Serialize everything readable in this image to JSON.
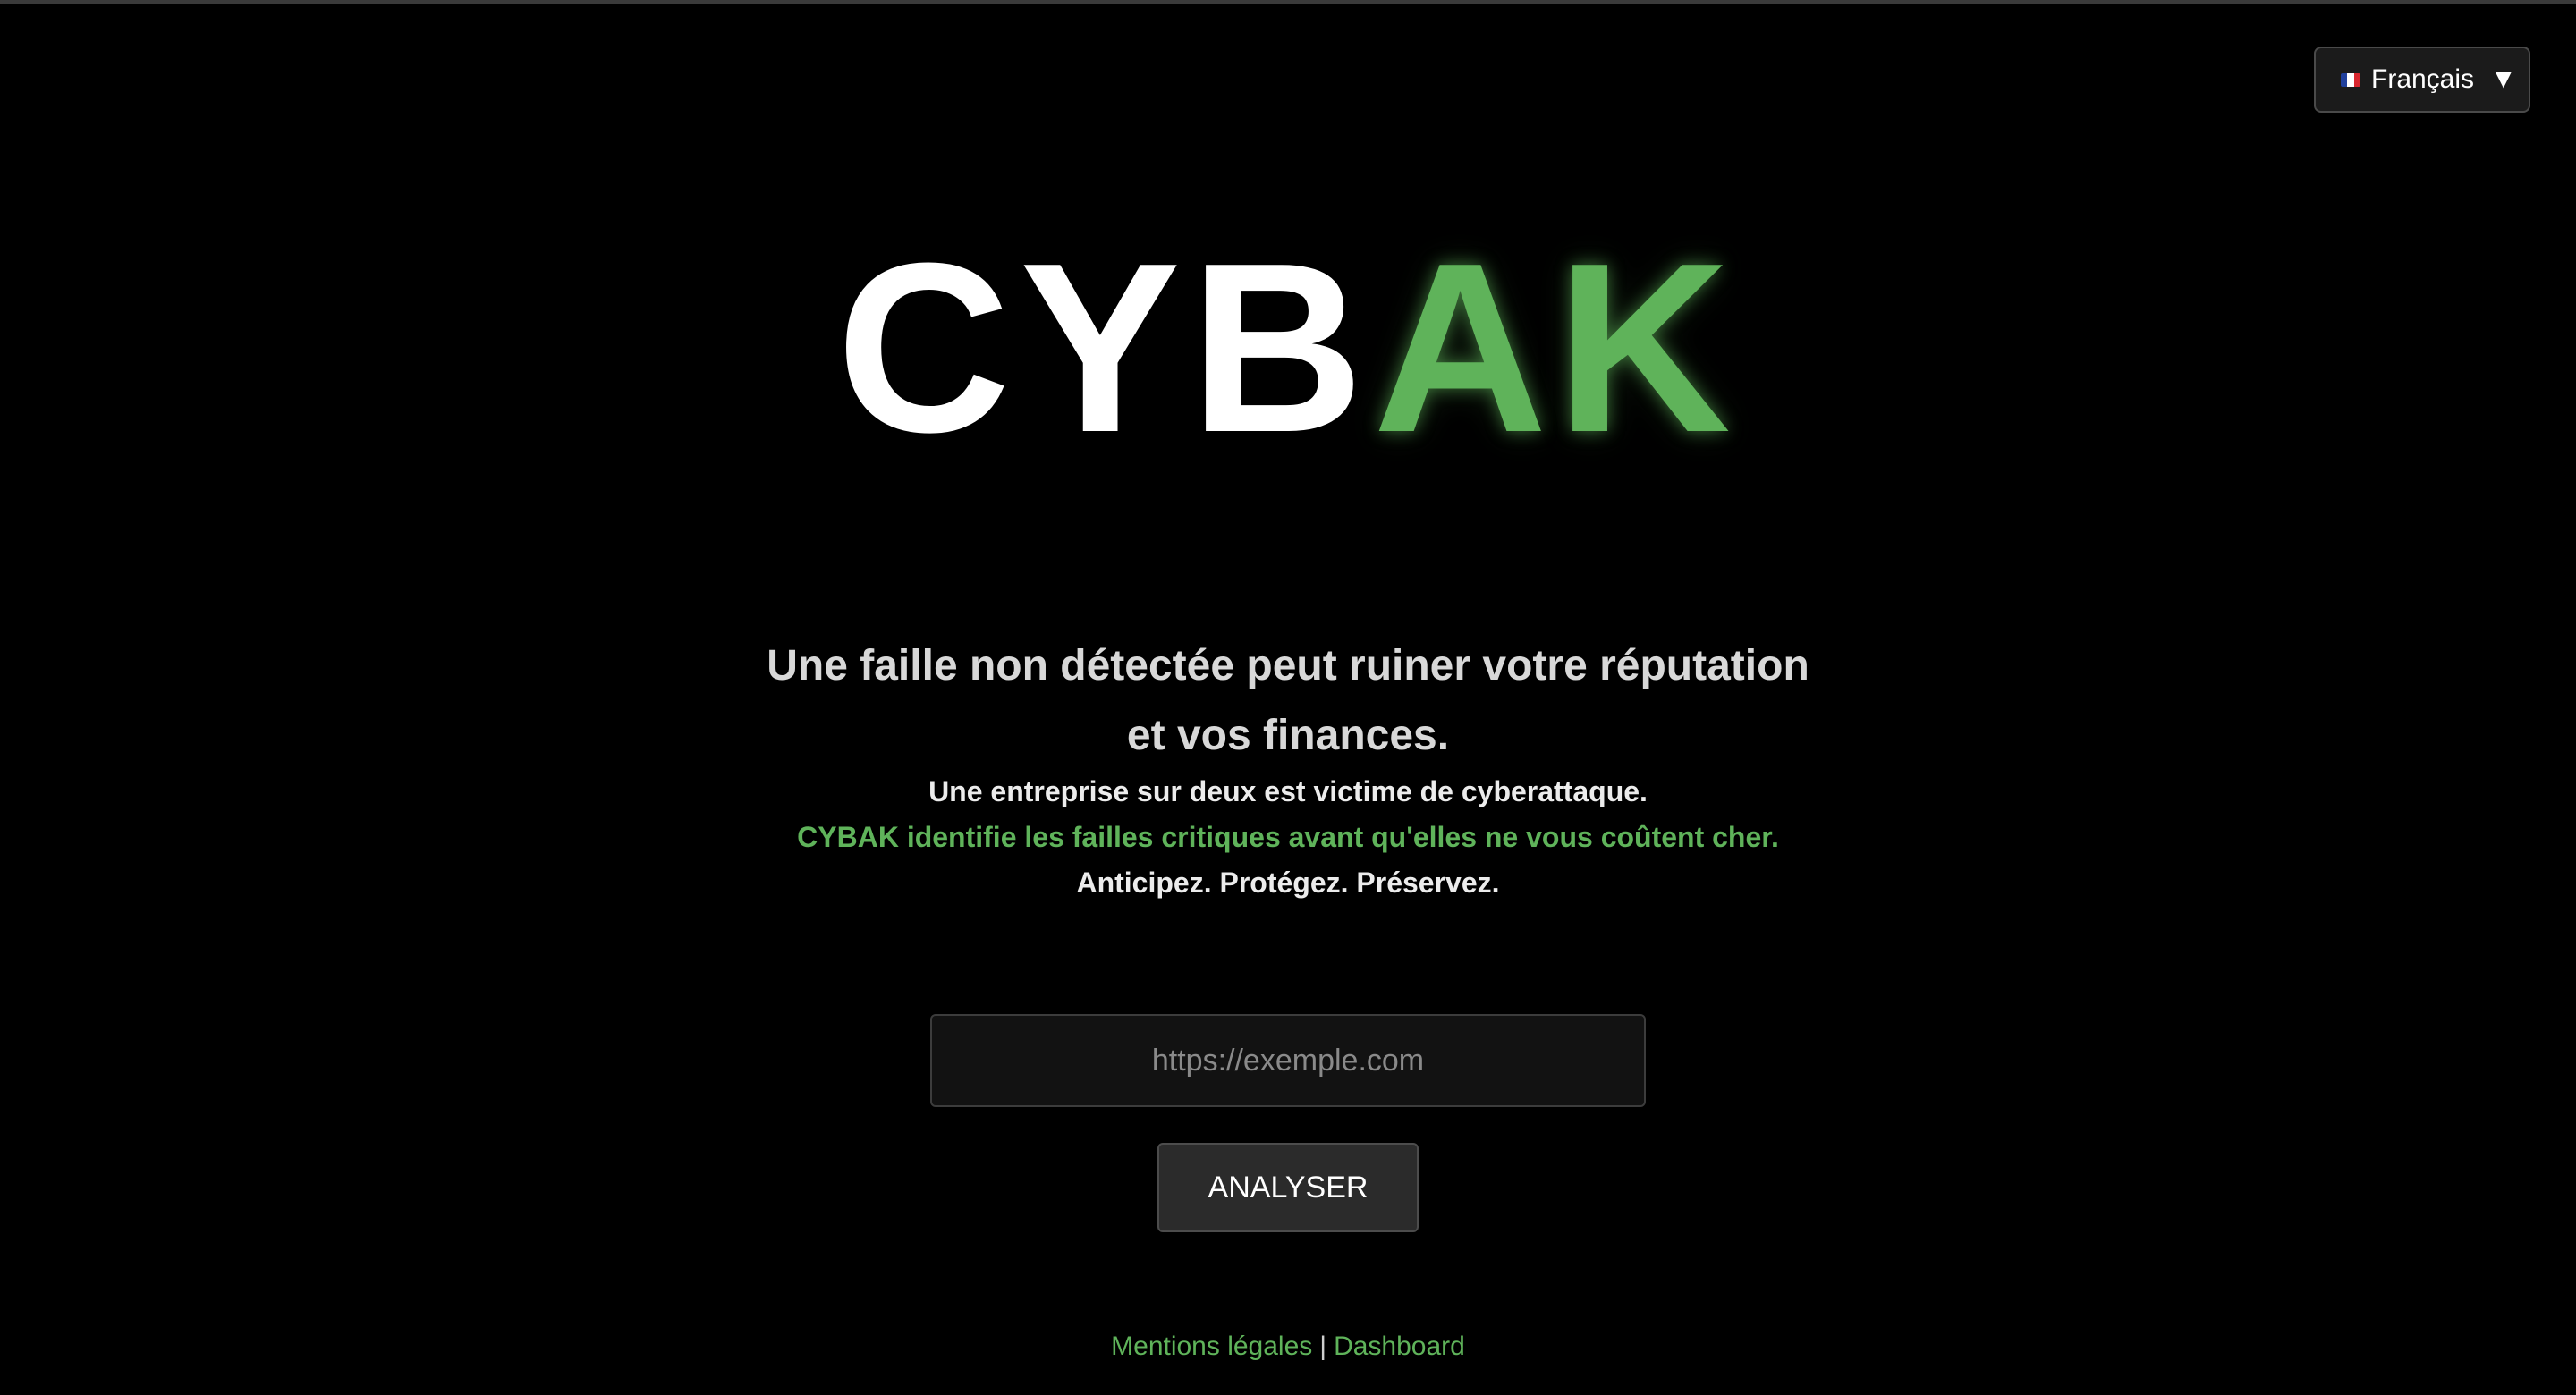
{
  "language_selector": {
    "label": "Français",
    "flag_icon": "france-flag-icon",
    "chevron_icon": "chevron-down-icon",
    "chevron_glyph": "▼"
  },
  "logo": {
    "part_white": "CYB",
    "part_green": "AK"
  },
  "hero": {
    "headline_line1": "Une faille non détectée peut ruiner votre réputation",
    "headline_line2": "et vos finances.",
    "subline1": "Une entreprise sur deux est victime de cyberattaque.",
    "subline2": "CYBAK identifie les failles critiques avant qu'elles ne vous coûtent cher.",
    "subline3": "Anticipez. Protégez. Préservez."
  },
  "form": {
    "url_placeholder": "https://exemple.com",
    "url_value": "",
    "analyze_label": "ANALYSER"
  },
  "footer": {
    "legal_link": "Mentions légales",
    "separator": "|",
    "dashboard_link": "Dashboard"
  },
  "colors": {
    "background": "#000000",
    "accent_green": "#5fb35a",
    "text_light": "#ececec"
  }
}
